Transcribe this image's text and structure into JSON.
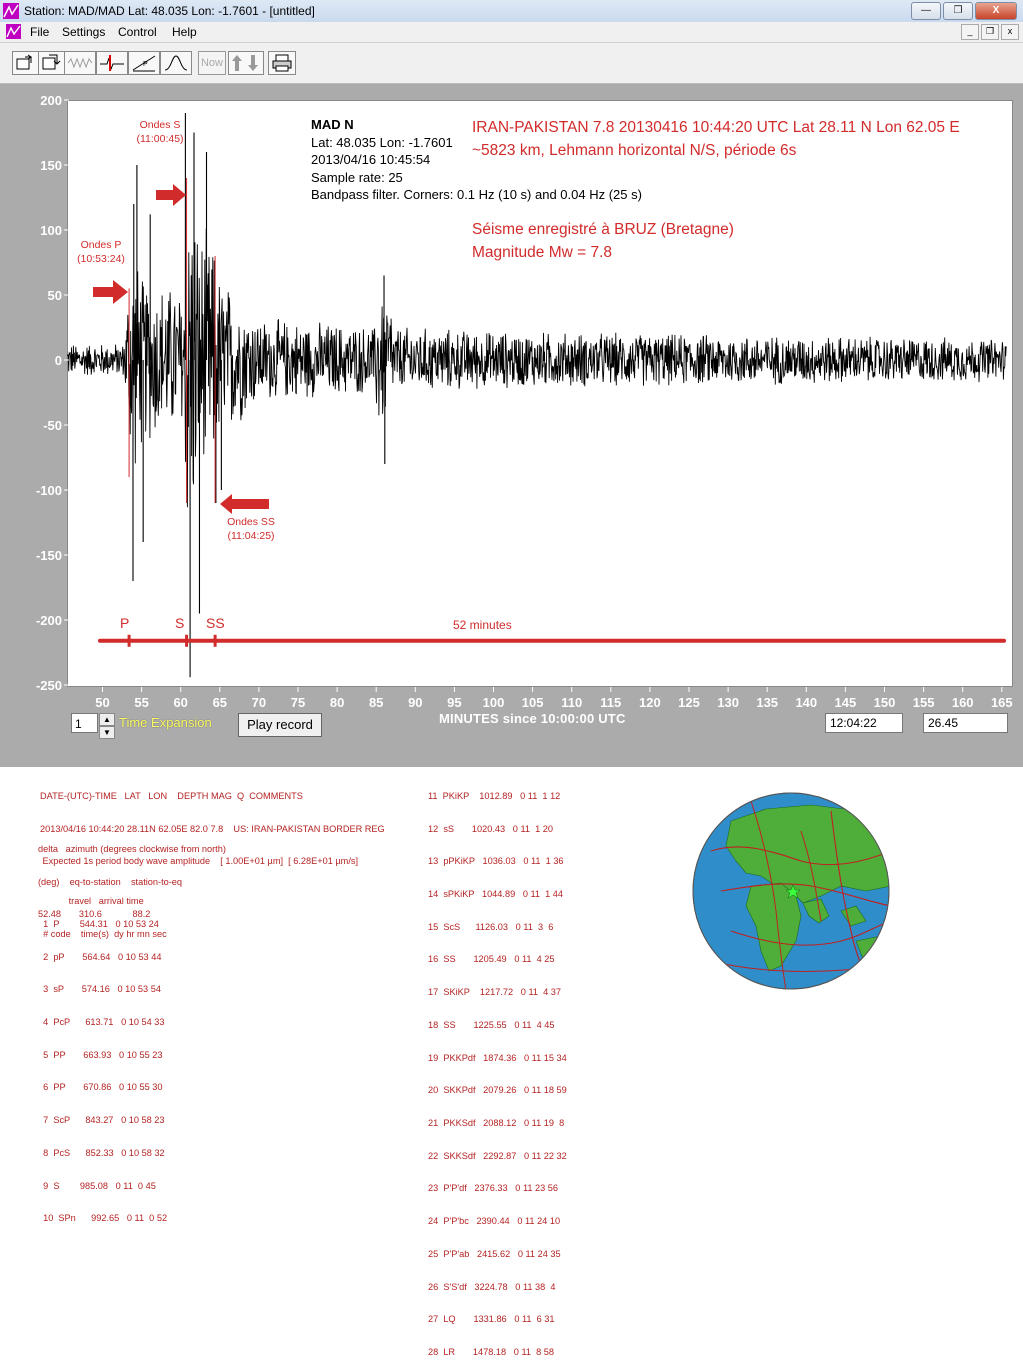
{
  "window": {
    "title": "Station: MAD/MAD Lat: 48.035 Lon: -1.7601 - [untitled]",
    "buttons": {
      "minimize": "—",
      "maximize": "❐",
      "close": "X"
    }
  },
  "menu": {
    "items": [
      "File",
      "Settings",
      "Control",
      "Help"
    ]
  },
  "toolbar": {
    "now_label": "Now"
  },
  "plot": {
    "header": {
      "station": "MAD  N",
      "latlon": "Lat: 48.035 Lon: -1.7601",
      "datetime": "2013/04/16 10:45:54",
      "sample_rate": "Sample rate: 25",
      "filter": "Bandpass filter. Corners: 0.1 Hz (10 s) and 0.04 Hz (25 s)"
    },
    "event_title": "IRAN-PAKISTAN 7.8 20130416 10:44:20 UTC Lat 28.11 N Lon 62.05 E",
    "event_subtitle": "~5823 km, Lehmann horizontal N/S, période 6s",
    "recorded_at": "Séisme enregistré à BRUZ (Bretagne)",
    "magnitude": "Magnitude Mw = 7.8",
    "annotations": {
      "p_title": "Ondes P",
      "p_time": "(10:53:24)",
      "s_title": "Ondes S",
      "s_time": "(11:00:45)",
      "ss_title": "Ondes SS",
      "ss_time": "(11:04:25)"
    },
    "timeline": {
      "p": "P",
      "s": "S",
      "ss": "SS",
      "duration": "52 minutes"
    }
  },
  "chart_data": {
    "type": "line",
    "xlabel": "MINUTES since 10:00:00 UTC",
    "xlim": [
      45,
      166
    ],
    "ylim": [
      -250,
      200
    ],
    "xticks": [
      50,
      55,
      60,
      65,
      70,
      75,
      80,
      85,
      90,
      95,
      100,
      105,
      110,
      115,
      120,
      125,
      130,
      135,
      140,
      145,
      150,
      155,
      160,
      165
    ],
    "yticks": [
      200,
      150,
      100,
      50,
      0,
      -50,
      -100,
      -150,
      -200,
      -250
    ],
    "phase_markers": {
      "P": 53.4,
      "S": 60.75,
      "SS": 64.4
    },
    "timeline_range": [
      45,
      165
    ],
    "envelope_segments": [
      {
        "x0": 45.0,
        "x1": 52.7,
        "amp0": 14,
        "amp1": 14
      },
      {
        "x0": 52.7,
        "x1": 53.4,
        "amp0": 14,
        "amp1": 70
      },
      {
        "x0": 53.4,
        "x1": 55.0,
        "amp0": 95,
        "amp1": 80
      },
      {
        "x0": 55.0,
        "x1": 60.5,
        "amp0": 70,
        "amp1": 60
      },
      {
        "x0": 60.5,
        "x1": 62.0,
        "amp0": 150,
        "amp1": 140
      },
      {
        "x0": 62.0,
        "x1": 64.5,
        "amp0": 115,
        "amp1": 95
      },
      {
        "x0": 64.5,
        "x1": 70.0,
        "amp0": 75,
        "amp1": 35
      },
      {
        "x0": 70.0,
        "x1": 85.0,
        "amp0": 35,
        "amp1": 28
      },
      {
        "x0": 85.0,
        "x1": 87.0,
        "amp0": 65,
        "amp1": 50
      },
      {
        "x0": 87.0,
        "x1": 100.0,
        "amp0": 28,
        "amp1": 24
      },
      {
        "x0": 100.0,
        "x1": 165.5,
        "amp0": 24,
        "amp1": 18
      }
    ],
    "spikes": [
      {
        "x": 53.9,
        "y": -170
      },
      {
        "x": 54.0,
        "y": 120
      },
      {
        "x": 54.4,
        "y": 150
      },
      {
        "x": 55.2,
        "y": -140
      },
      {
        "x": 56.1,
        "y": 112
      },
      {
        "x": 60.6,
        "y": 190
      },
      {
        "x": 61.2,
        "y": -244
      },
      {
        "x": 61.7,
        "y": 175
      },
      {
        "x": 62.4,
        "y": -195
      },
      {
        "x": 63.3,
        "y": 160
      },
      {
        "x": 64.5,
        "y": -110
      },
      {
        "x": 65.2,
        "y": -100
      },
      {
        "x": 86.0,
        "y": 65
      },
      {
        "x": 86.1,
        "y": -80
      }
    ]
  },
  "controls": {
    "expansion_value": "1",
    "time_expansion_label": "Time Expansion",
    "play_button": "Play record",
    "clock": "12:04:22",
    "amplitude": "26.45"
  },
  "event_info": {
    "header_lines": [
      "DATE-(UTC)-TIME   LAT   LON    DEPTH MAG  Q  COMMENTS",
      "2013/04/16 10:44:20 28.11N 62.05E 82.0 7.8    US: IRAN-PAKISTAN BORDER REG",
      " Expected 1s period body wave amplitude    [ 1.00E+01 µm]  [ 6.28E+01 µm/s]"
    ],
    "geo_lines": [
      "delta   azimuth (degrees clockwise from north)",
      "(deg)    eq-to-station    station-to-eq",
      "52.48       310.6            88.2"
    ],
    "table_header": [
      "            travel   arrival time",
      "  # code    time(s)  dy hr mn sec"
    ],
    "phases_left": [
      "  1  P        544.31   0 10 53 24",
      "  2  pP       564.64   0 10 53 44",
      "  3  sP       574.16   0 10 53 54",
      "  4  PcP      613.71   0 10 54 33",
      "  5  PP       663.93   0 10 55 23",
      "  6  PP       670.86   0 10 55 30",
      "  7  ScP      843.27   0 10 58 23",
      "  8  PcS      852.33   0 10 58 32",
      "  9  S        985.08   0 11  0 45",
      "  10  SPn      992.65   0 11  0 52"
    ],
    "phases_right": [
      "11  PKiKP    1012.89   0 11  1 12",
      "12  sS       1020.43   0 11  1 20",
      "13  pPKiKP   1036.03   0 11  1 36",
      "14  sPKiKP   1044.89   0 11  1 44",
      "15  ScS      1126.03   0 11  3  6",
      "16  SS       1205.49   0 11  4 25",
      "17  SKiKP    1217.72   0 11  4 37",
      "18  SS       1225.55   0 11  4 45",
      "19  PKKPdf   1874.36   0 11 15 34",
      "20  SKKPdf   2079.26   0 11 18 59",
      "21  PKKSdf   2088.12   0 11 19  8",
      "22  SKKSdf   2292.87   0 11 22 32",
      "23  P'P'df   2376.33   0 11 23 56",
      "24  P'P'bc   2390.44   0 11 24 10",
      "25  P'P'ab   2415.62   0 11 24 35",
      "26  S'S'df   3224.78   0 11 38  4",
      "27  LQ       1331.86   0 11  6 31",
      "28  LR       1478.18   0 11  8 58"
    ]
  },
  "colors": {
    "annotation_red": "#d22b2b",
    "trace": "#000000",
    "workspace": "#ababab"
  }
}
